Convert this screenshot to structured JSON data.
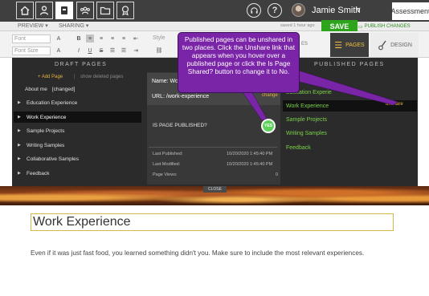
{
  "topnav": {
    "icons": [
      "home-icon",
      "profile-icon",
      "portfolio-icon",
      "groups-icon",
      "folder-icon",
      "badge-icon"
    ],
    "active_icon": "portfolio-icon",
    "help_icons": [
      "support-icon",
      "help-icon"
    ],
    "help_symbol": "?",
    "user_name": "Jamie Smith",
    "chevron": "∨",
    "assessment_label": "Assessment"
  },
  "subbar": {
    "preview_label": "PREVIEW",
    "sharing_label": "SHARING",
    "saved_status": "saved 1 hour ago",
    "save_label": "SAVE",
    "publish_label": "PUBLISH CHANGES"
  },
  "toolbar": {
    "font_placeholder": "Font",
    "font_size_placeholder": "Font Size",
    "style_placeholder": "Style",
    "tab_partial": "ES",
    "pages_label": "PAGES",
    "design_label": "DESIGN"
  },
  "draft_pages": {
    "title": "DRAFT PAGES",
    "add_page": "+ Add Page",
    "separator": "|",
    "show_deleted": "show deleted pages",
    "about": "About me",
    "about_status": "[changed]",
    "items": [
      {
        "label": "Education Experience",
        "active": false
      },
      {
        "label": "Work Experience",
        "active": true
      },
      {
        "label": "Sample Projects",
        "active": false
      },
      {
        "label": "Writing Samples",
        "active": false
      },
      {
        "label": "Collaborative Samples",
        "active": false
      },
      {
        "label": "Feedback",
        "active": false
      }
    ]
  },
  "details": {
    "name_label": "Name: Wo",
    "url_label": "URL: /work-experience",
    "change_link": "change",
    "published_question": "IS PAGE PUBLISHED?",
    "toggle_label": "YES",
    "last_published_label": "Last Published:",
    "last_published_value": "10/20/2020 1:45:40 PM",
    "last_modified_label": "Last Modified:",
    "last_modified_value": "10/20/2020 1:45:40 PM",
    "page_views_label": "Page Views:",
    "page_views_value": "0"
  },
  "published_pages": {
    "title": "PUBLISHED PAGES",
    "items": [
      "Education Experie",
      "Work Experience",
      "Sample Projects",
      "Writing Samples",
      "Feedback"
    ],
    "active_index": 1,
    "unshare_label": "unshare"
  },
  "callout": {
    "text": "Published pages can be unshared in two places.  Click the Unshare link that appears when you hover over a published page or click the Is Page Shared? button to change it to No."
  },
  "banner": {
    "close_label": "CLOSE"
  },
  "content": {
    "heading": "Work Experience",
    "body": "Even if it was just fast food, you learned something didn't you. Make sure to include the most relevant experiences."
  },
  "colors": {
    "accent_green": "#2ea41d",
    "link_gold": "#e6b33c",
    "published_green": "#7bd148",
    "callout_purple": "#7a24a8",
    "dark_panel": "#2b2b2b"
  }
}
